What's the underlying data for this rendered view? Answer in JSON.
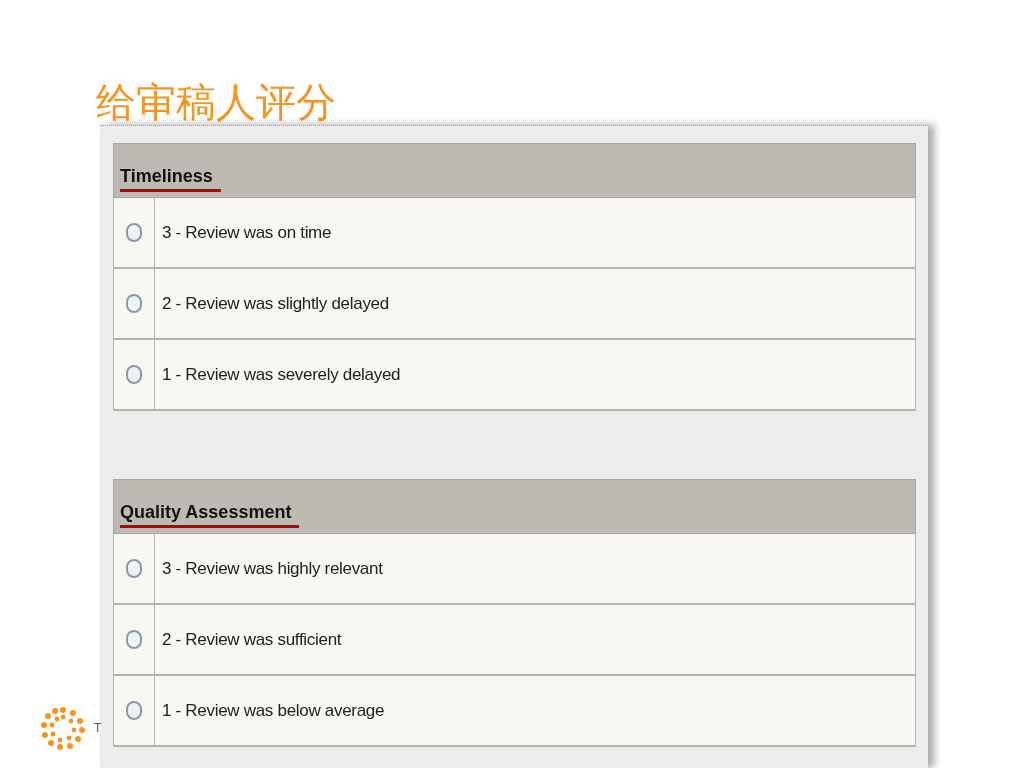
{
  "slide_title": "给审稿人评分",
  "sections": [
    {
      "title": "Timeliness",
      "options": [
        {
          "label": "3 - Review was on time",
          "selected": false
        },
        {
          "label": "2 - Review was slightly delayed",
          "selected": false
        },
        {
          "label": "1 - Review was severely delayed",
          "selected": false
        }
      ]
    },
    {
      "title": "Quality Assessment",
      "options": [
        {
          "label": "3 - Review was highly relevant",
          "selected": false
        },
        {
          "label": "2 - Review was sufficient",
          "selected": false
        },
        {
          "label": "1 - Review was below average",
          "selected": false
        }
      ]
    }
  ],
  "logo_text": "T"
}
